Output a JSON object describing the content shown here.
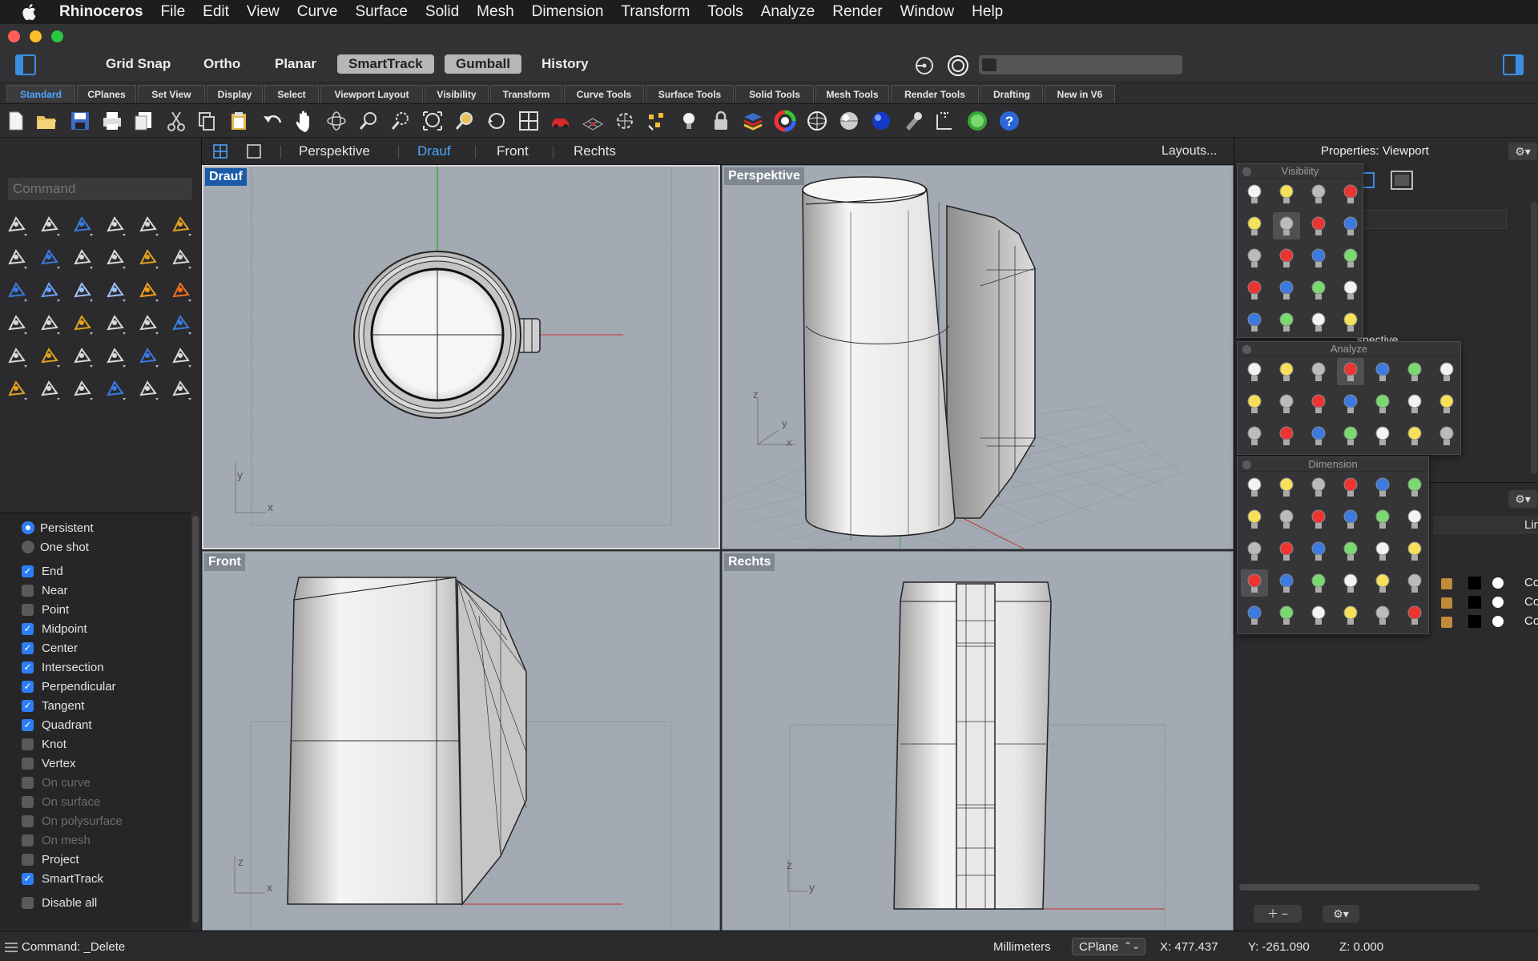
{
  "menubar": {
    "app": "Rhinoceros",
    "items": [
      "File",
      "Edit",
      "View",
      "Curve",
      "Surface",
      "Solid",
      "Mesh",
      "Dimension",
      "Transform",
      "Tools",
      "Analyze",
      "Render",
      "Window",
      "Help"
    ]
  },
  "toggles": {
    "grid_snap": "Grid Snap",
    "ortho": "Ortho",
    "planar": "Planar",
    "smarttrack": "SmartTrack",
    "gumball": "Gumball",
    "history": "History"
  },
  "tabs": [
    "Standard",
    "CPlanes",
    "Set View",
    "Display",
    "Select",
    "Viewport Layout",
    "Visibility",
    "Transform",
    "Curve Tools",
    "Surface Tools",
    "Solid Tools",
    "Mesh Tools",
    "Render Tools",
    "Drafting",
    "New in V6"
  ],
  "command": {
    "placeholder": "Command"
  },
  "viewport_tabs": {
    "perspektive": "Perspektive",
    "drauf": "Drauf",
    "front": "Front",
    "rechts": "Rechts",
    "layouts": "Layouts..."
  },
  "viewports": {
    "top": "Drauf",
    "perspective": "Perspektive",
    "front": "Front",
    "right": "Rechts"
  },
  "osnap": {
    "persistent": "Persistent",
    "one_shot": "One shot",
    "items": [
      {
        "label": "End",
        "checked": true,
        "enabled": true
      },
      {
        "label": "Near",
        "checked": false,
        "enabled": true
      },
      {
        "label": "Point",
        "checked": false,
        "enabled": true
      },
      {
        "label": "Midpoint",
        "checked": true,
        "enabled": true
      },
      {
        "label": "Center",
        "checked": true,
        "enabled": true
      },
      {
        "label": "Intersection",
        "checked": true,
        "enabled": true
      },
      {
        "label": "Perpendicular",
        "checked": true,
        "enabled": true
      },
      {
        "label": "Tangent",
        "checked": true,
        "enabled": true
      },
      {
        "label": "Quadrant",
        "checked": true,
        "enabled": true
      },
      {
        "label": "Knot",
        "checked": false,
        "enabled": true
      },
      {
        "label": "Vertex",
        "checked": false,
        "enabled": true
      },
      {
        "label": "On curve",
        "checked": false,
        "enabled": false
      },
      {
        "label": "On surface",
        "checked": false,
        "enabled": false
      },
      {
        "label": "On polysurface",
        "checked": false,
        "enabled": false
      },
      {
        "label": "On mesh",
        "checked": false,
        "enabled": false
      },
      {
        "label": "Project",
        "checked": false,
        "enabled": true
      },
      {
        "label": "SmartTrack",
        "checked": true,
        "enabled": true
      }
    ],
    "disable_all": "Disable all"
  },
  "properties": {
    "title": "Properties: Viewport",
    "partial_text": "spective"
  },
  "popups": {
    "visibility": "Visibility",
    "analyze": "Analyze",
    "dimension": "Dimension"
  },
  "layers": {
    "column": "Lin",
    "rows": [
      "Co",
      "Co",
      "Co"
    ]
  },
  "status": {
    "command": "Command: _Delete",
    "units": "Millimeters",
    "cplane": "CPlane",
    "x": "X: 477.437",
    "y": "Y: -261.090",
    "z": "Z: 0.000"
  },
  "colors": {
    "accent": "#2d7df6",
    "active_tab": "#4ea6ff",
    "viewport_bg": "#a3aab3",
    "active_label": "#1a5aa8"
  }
}
